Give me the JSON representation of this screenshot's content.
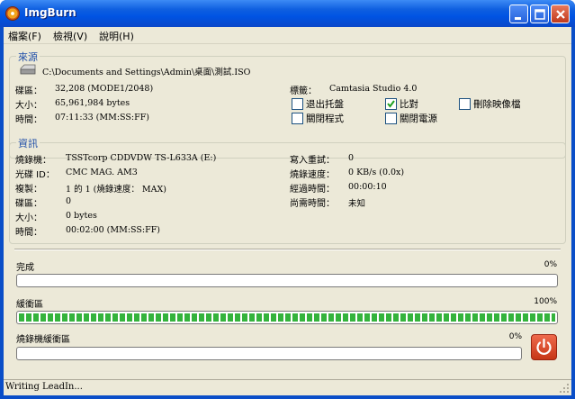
{
  "window": {
    "title": "ImgBurn"
  },
  "menu": [
    {
      "label": "檔案(F)"
    },
    {
      "label": "檢視(V)"
    },
    {
      "label": "說明(H)"
    }
  ],
  "source": {
    "group_title": "來源",
    "path": "C:\\Documents and Settings\\Admin\\桌面\\測試.ISO",
    "sectors_label": "碟區：",
    "sectors_value": "32,208 (MODE1/2048)",
    "size_label": "大小：",
    "size_value": "65,961,984 bytes",
    "time_label": "時間：",
    "time_value": "07:11:33 (MM:SS:FF)",
    "volume_label": "標籤：",
    "volume_value": "Camtasia Studio 4.0",
    "checkboxes": [
      {
        "label": "退出托盤",
        "checked": false
      },
      {
        "label": "比對",
        "checked": true
      },
      {
        "label": "刪除映像檔",
        "checked": false
      },
      {
        "label": "關閉程式",
        "checked": false
      },
      {
        "label": "關閉電源",
        "checked": false
      }
    ]
  },
  "info": {
    "group_title": "資訊",
    "rows_left": [
      {
        "label": "燒錄機：",
        "value": "TSSTcorp CDDVDW TS-L633A (E:)"
      },
      {
        "label": "光碟 ID：",
        "value": "CMC MAG. AM3"
      },
      {
        "label": "複製：",
        "value": "1 的 1 (燒錄速度： MAX)"
      },
      {
        "label": "碟區：",
        "value": "0"
      },
      {
        "label": "大小：",
        "value": "0 bytes"
      },
      {
        "label": "時間：",
        "value": "00:02:00 (MM:SS:FF)"
      }
    ],
    "rows_right": [
      {
        "label": "寫入重試：",
        "value": "0"
      },
      {
        "label": "燒錄速度：",
        "value": "0 KB/s (0.0x)"
      },
      {
        "label": "經過時間：",
        "value": "00:00:10"
      },
      {
        "label": "尚需時間：",
        "value": "未知"
      }
    ]
  },
  "progress": [
    {
      "label": "完成",
      "percent_text": "0%",
      "value": 0
    },
    {
      "label": "緩衝區",
      "percent_text": "100%",
      "value": 1.0
    },
    {
      "label": "燒錄機緩衝區",
      "percent_text": "0%",
      "value": 0
    }
  ],
  "status": {
    "text": "Writing LeadIn..."
  },
  "colors": {
    "titlebar": "#0054e3",
    "progress_fill": "#34b33c",
    "group_title": "#1f4ea8",
    "power_button": "#c63616"
  },
  "icons": {
    "app": "imgburn-icon",
    "drive": "drive-icon",
    "power": "power-icon"
  }
}
